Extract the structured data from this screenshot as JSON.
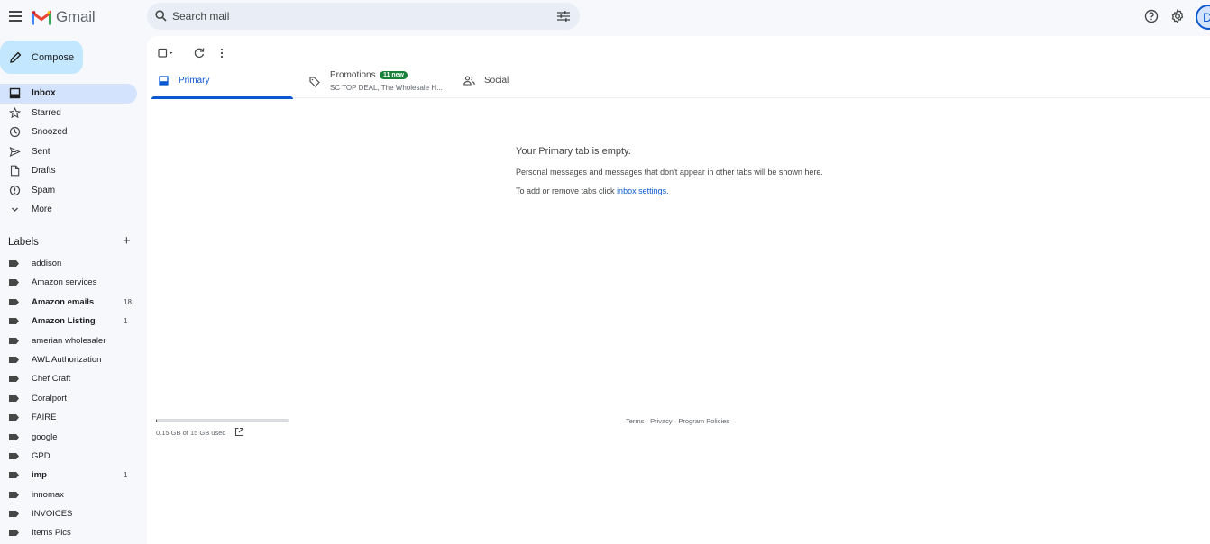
{
  "header": {
    "app_name": "Gmail",
    "search_placeholder": "Search mail",
    "avatar_letter": "D"
  },
  "compose": {
    "label": "Compose"
  },
  "nav": [
    {
      "label": "Inbox",
      "icon": "inbox-icon",
      "active": true
    },
    {
      "label": "Starred",
      "icon": "star-icon"
    },
    {
      "label": "Snoozed",
      "icon": "clock-icon"
    },
    {
      "label": "Sent",
      "icon": "send-icon"
    },
    {
      "label": "Drafts",
      "icon": "draft-icon"
    },
    {
      "label": "Spam",
      "icon": "spam-icon"
    },
    {
      "label": "More",
      "icon": "chevron-down-icon"
    }
  ],
  "labels": {
    "title": "Labels",
    "items": [
      {
        "name": "addison",
        "count": ""
      },
      {
        "name": "Amazon services",
        "count": ""
      },
      {
        "name": "Amazon emails",
        "count": "18",
        "bold": true
      },
      {
        "name": "Amazon Listing",
        "count": "1",
        "bold": true
      },
      {
        "name": "amerian wholesaler",
        "count": ""
      },
      {
        "name": "AWL Authorization",
        "count": ""
      },
      {
        "name": "Chef Craft",
        "count": ""
      },
      {
        "name": "Coralport",
        "count": ""
      },
      {
        "name": "FAIRE",
        "count": ""
      },
      {
        "name": "google",
        "count": ""
      },
      {
        "name": "GPD",
        "count": ""
      },
      {
        "name": "imp",
        "count": "1",
        "bold": true
      },
      {
        "name": "innomax",
        "count": ""
      },
      {
        "name": "INVOICES",
        "count": ""
      },
      {
        "name": "Items Pics",
        "count": ""
      }
    ]
  },
  "tabs": {
    "primary": "Primary",
    "promotions": "Promotions",
    "promotions_badge": "11 new",
    "promotions_sub": "SC TOP DEAL, The Wholesale H...",
    "social": "Social"
  },
  "empty": {
    "heading": "Your Primary tab is empty.",
    "line1": "Personal messages and messages that don't appear in other tabs will be shown here.",
    "line2_prefix": "To add or remove tabs click ",
    "line2_link": "inbox settings."
  },
  "storage": {
    "text": "0.15 GB of 15 GB used",
    "used_fraction": 0.01
  },
  "footer": {
    "terms": "Terms",
    "privacy": "Privacy",
    "policies": "Program Policies",
    "sep": " · "
  },
  "colors": {
    "accent": "#0b57d0",
    "active_nav": "#d3e3fd",
    "compose_bg": "#c2e7ff",
    "badge_green": "#188038"
  }
}
